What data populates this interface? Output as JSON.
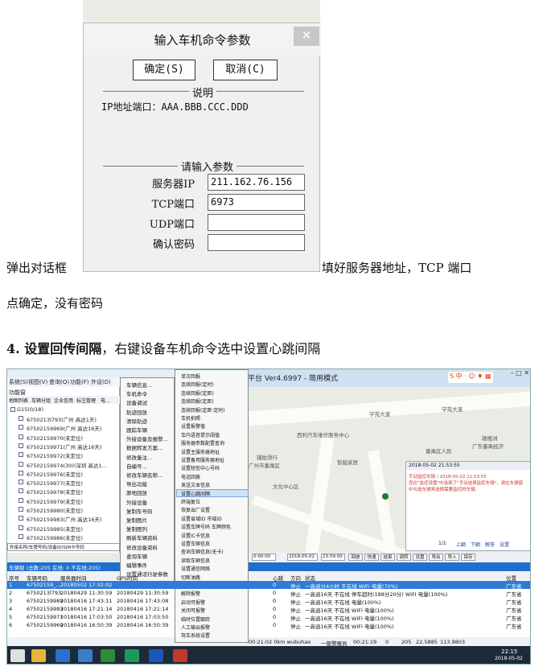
{
  "dialog": {
    "title": "输入车机命令参数",
    "close_glyph": "✕",
    "ok_label": "确定(S)",
    "cancel_label": "取消(C)",
    "note_group": "说明",
    "note_text": "IP地址端口：AAA.BBB.CCC.DDD",
    "param_group": "请输入参数",
    "fields": [
      {
        "label": "服务器IP",
        "value": "211.162.76.156"
      },
      {
        "label": "TCP端口",
        "value": "6973"
      },
      {
        "label": "UDP端口",
        "value": ""
      },
      {
        "label": "确认密码",
        "value": ""
      }
    ]
  },
  "body": {
    "line1_left": "弹出对话框",
    "line1_right": "填好服务器地址，TCP 端口",
    "line2": "点确定，没有密码",
    "heading_bold": "4. 设置回传间隔",
    "heading_rest": "，右键设备车机命令选中设置心跳间隔"
  },
  "app": {
    "title": "平台 Ver4.6997 - 简用模式",
    "menu": [
      "系统(S)",
      "视图(V)",
      "查询(Q)",
      "功能(F)",
      "外设(D)"
    ],
    "left_tabs": [
      "地图列表",
      "车辆分组",
      "企业信用",
      "标注管理",
      "电…"
    ],
    "pane_title": "功能窗",
    "group": "G15(0/18)",
    "vehicles": [
      "6750213l793(广州 高达1天)",
      "67502159969(广州 高达16天)",
      "67502159970(未定位)",
      "67502159971(广州 高达16天)",
      "67502159972(未定位)",
      "67502159974(30)(深圳 高达1…",
      "67502159976(未定位)",
      "67502159977(未定位)",
      "67502159978(未定位)",
      "67502159979(未定位)",
      "67502159980(未定位)",
      "67502159983(广州 高达16天)",
      "67502159985(未定位)",
      "67502159986(未定位)"
    ],
    "search_hint": "外接名称/车牌号码/设备ID/SIM卡号码",
    "ctx_main": [
      "车辆信息...",
      "车机命令",
      "设备调试",
      "轨迹回放",
      "清除轨迹",
      "跟踪车辆",
      "外接设备及报警...",
      "数据转发方案...",
      "修改备注...",
      "自编号...",
      "修改车辆名称...",
      "导出功能",
      "原地回放",
      "外接设备",
      "复制车号码",
      "复制图片",
      "复制图列",
      "刷新车辆资料",
      "修改设备资料",
      "查询车辆",
      "编辑事件",
      "设置通话行驶参数",
      "服务"
    ],
    "ctx_sub": [
      "单次回报",
      "连续回报(定时)",
      "连续回报(定距)",
      "连续回报(定距)",
      "连续回报(定距·定时)",
      "车机拍照",
      "设置报警值",
      "车内语音提示阈值",
      "服务器参数配置查询",
      "设置主服务器地址",
      "设置备用服务器地址",
      "设置短信中心号码",
      "电话回拨",
      "发送文本信息",
      "设置心跳间隔",
      "终端复位",
      "恢复出厂设置",
      "设置省域ID 市域ID",
      "设置车牌号码 车牌颜色",
      "设置IC卡信息",
      "设置车辆信息",
      "查询车辆信息(无卡)",
      "读取车辆信息",
      "设置通信网络",
      "切断油路",
      "恢复油路",
      "解除报警",
      "启动可报警",
      "关闭可报警",
      "临时位置跟踪",
      "人工输出报警",
      "驾车系统设置"
    ],
    "map_labels": [
      "学苑大道",
      "学苑大道",
      "西利汽车维修服务中心",
      "辅助滑行",
      "广州市番禺区",
      "智能家居",
      "雄楼洲",
      "广东番禺经济",
      "番禺区人民",
      "文化中心区"
    ],
    "popup": {
      "header": "2018-05-02 21:53:55",
      "line1": "手动监控车辆 / 2018-05-02 21:53:55",
      "line2": "您在\"监控设置\"中选择了\"手动选择监控车辆\"，请在车辆窗",
      "line3": "中勾选车辆来选择需要监控的车辆。",
      "page": "1/1",
      "actions": [
        "上翻",
        "下翻",
        "解答",
        "设置"
      ]
    },
    "time_from": "0:00:00",
    "date_to": "2018-05-02",
    "time_to": "23:59:00",
    "toolbar_btns": [
      "回放",
      "快速",
      "结束",
      "调转",
      "设置",
      "导出",
      "导入",
      "保存"
    ],
    "table_caption": "车辆窗 (总数:205 在线: 0 不在线:205)",
    "table_cols": [
      "序号",
      "车辆号码",
      "服务器时间",
      "GPS时间",
      "心跳",
      "方向",
      "状态",
      "位置"
    ],
    "rows": [
      [
        "1",
        "67502159_...",
        "20180502 17:32:02",
        "",
        "0",
        "停止",
        "一高迪分4小时 不在线 WIFI 电量(70%)",
        "广东省"
      ],
      [
        "2",
        "6750213l793",
        "20180429 11:30:59",
        "20180429 11:30:59",
        "0",
        "停止",
        "一高迪16天 不在线 停车超时(188分20分) WIFI 电量(100%)",
        "广东省"
      ],
      [
        "3",
        "67502159989",
        "20180416 17:43:11",
        "20180416 17:43:08",
        "0",
        "停止",
        "一高迪16天 不在线 电量(100%)",
        "广东省"
      ],
      [
        "4",
        "67502159983",
        "20180416 17:21:14",
        "20180416 17:21:14",
        "0",
        "停止",
        "一高迪16天 不在线 WIFI 电量(100%)",
        "广东省"
      ],
      [
        "5",
        "67502159971",
        "20180416 17:03:50",
        "20180416 17:03:50",
        "0",
        "停止",
        "一高迪16天 不在线 WIFI 电量(100%)",
        "广东省"
      ],
      [
        "6",
        "67502159969",
        "20180416 16:50:39",
        "20180416 16:50:39",
        "0",
        "停止",
        "一高迪16天 不在线 WIFI 电量(100%)",
        "广东省"
      ]
    ],
    "status_bar": [
      "00:21:02 0km wubuhao",
      "一般警报员",
      "00:21:19",
      "0",
      "205",
      "22.5885",
      "113.9803"
    ],
    "clock_time": "22:15",
    "clock_date": "2018-05-02"
  },
  "colors": {
    "highlight": "#cce1f6",
    "taskbar": "#1e2a38",
    "table_caption": "#1f6fd1"
  }
}
